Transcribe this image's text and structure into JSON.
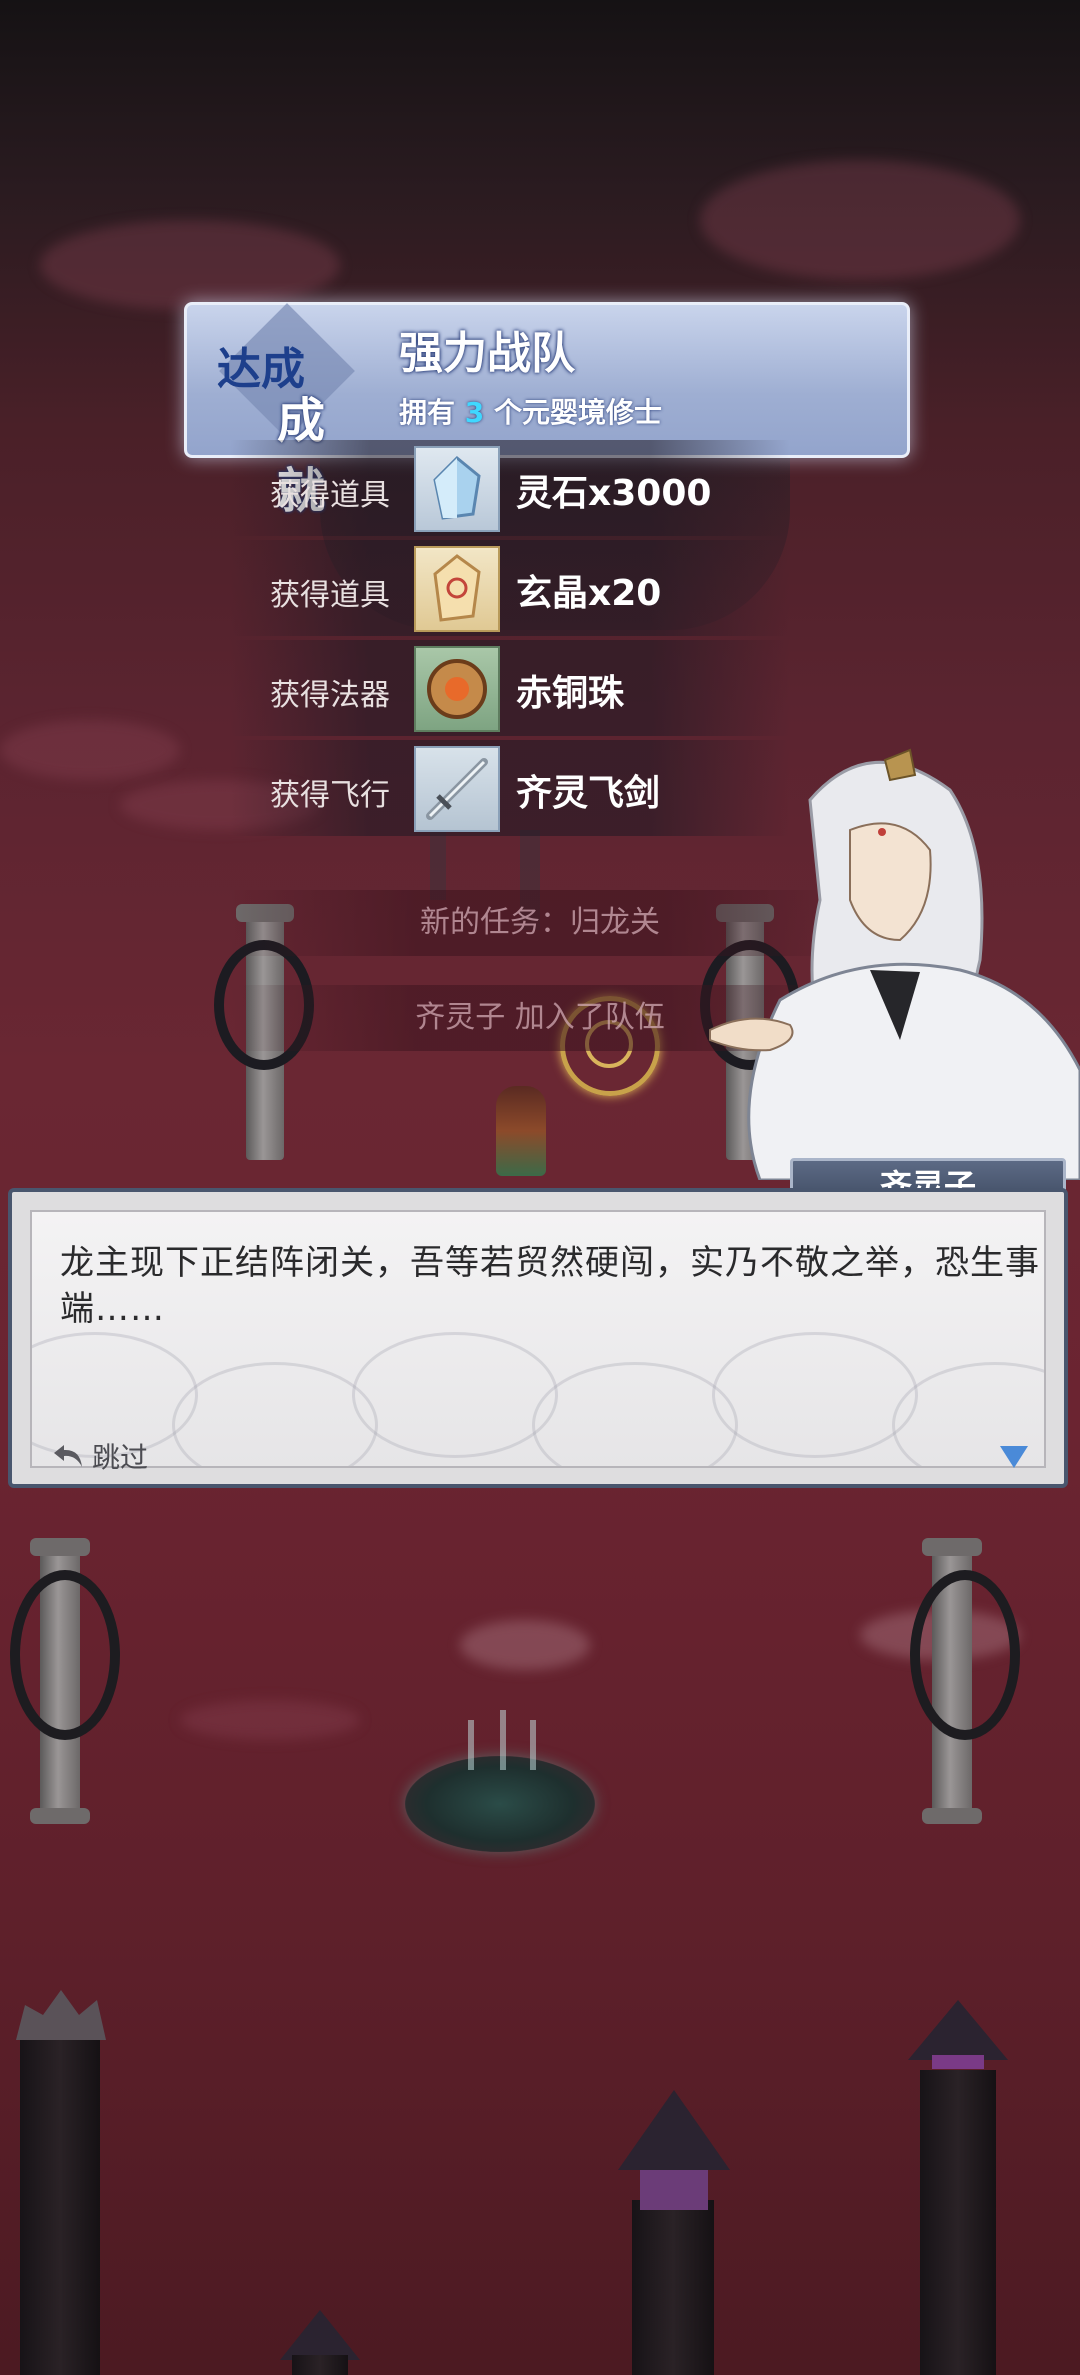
{
  "achievement": {
    "badge_line1": "达成",
    "badge_line2": "成就",
    "title": "强力战队",
    "desc_prefix": "拥有",
    "desc_num": "3",
    "desc_suffix": "个元婴境修士"
  },
  "rewards": [
    {
      "label": "获得道具",
      "name": "灵石x3000",
      "icon": "spirit-stone-icon"
    },
    {
      "label": "获得道具",
      "name": "玄晶x20",
      "icon": "mystic-crystal-icon"
    },
    {
      "label": "获得法器",
      "name": "赤铜珠",
      "icon": "red-copper-bead-icon"
    },
    {
      "label": "获得飞行",
      "name": "齐灵飞剑",
      "icon": "flying-sword-icon"
    }
  ],
  "tasks": [
    {
      "text": "新的任务：归龙关"
    },
    {
      "text": "齐灵子 加入了队伍"
    }
  ],
  "dialog": {
    "speaker": "齐灵子",
    "text": "龙主现下正结阵闭关，吾等若贸然硬闯，实乃不敬之举，恐生事端……",
    "skip_label": "跳过"
  },
  "colors": {
    "accent_cyan": "#3fd8ff",
    "next_arrow": "#4a8ad8"
  }
}
